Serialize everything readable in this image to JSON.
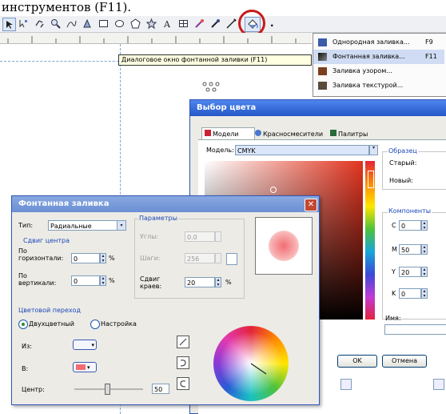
{
  "heading": "инструментов (F11).",
  "toolbar": {
    "icons": [
      "pick-tool",
      "shape-tool",
      "crop-tool",
      "zoom-tool",
      "freehand-tool",
      "rectangle-tool",
      "ellipse-tool",
      "polygon-tool",
      "text-tool",
      "table-tool",
      "interactive-tool",
      "eyedropper-tool",
      "outline-tool",
      "fill-tool"
    ]
  },
  "tooltip": "Диалоговое окно фонтанной заливки (F11)",
  "fill_menu": {
    "items": [
      {
        "label": "Однородная заливка...",
        "shortcut": "F9",
        "color": "#3b5ca8"
      },
      {
        "label": "Фонтанная заливка...",
        "shortcut": "F11",
        "color": "#2b2b2b"
      },
      {
        "label": "Заливка узором...",
        "shortcut": "",
        "color": "#7b3f1e"
      },
      {
        "label": "Заливка текстурой...",
        "shortcut": "",
        "color": "#5a4a3a"
      }
    ]
  },
  "color_picker": {
    "title": "Выбор цвета",
    "tabs": [
      "Модели",
      "Красносмесители",
      "Палитры"
    ],
    "model_label": "Модель:",
    "model_value": "CMYK",
    "sample_label": "Образец",
    "old_label": "Старый:",
    "new_label": "Новый:",
    "components_label": "Компоненты",
    "components": [
      {
        "name": "C",
        "value": "0"
      },
      {
        "name": "M",
        "value": "50"
      },
      {
        "name": "Y",
        "value": "20"
      },
      {
        "name": "K",
        "value": "0"
      }
    ],
    "name_label": "Имя:",
    "ok_label": "OK",
    "cancel_label": "Отмена"
  },
  "fountain": {
    "title": "Фонтанная заливка",
    "type_label": "Тип:",
    "type_value": "Радиальные",
    "center_label": "Сдвиг центра",
    "horizontal_label": "По горизонтали:",
    "horizontal_value": "0",
    "vertical_label": "По вертикали:",
    "vertical_value": "0",
    "percent": "%",
    "params_label": "Параметры",
    "steps_label": "Углы:",
    "steps_value": "0.0",
    "shift_label": "Шаги:",
    "shift_value": "256",
    "edge_label": "Сдвиг краев:",
    "edge_value": "20",
    "blend_label": "Цветовой переход",
    "two_color_label": "Двухцветный",
    "custom_label": "Настройка",
    "from_label": "Из:",
    "to_label": "В:",
    "mid_label": "Центр:",
    "mid_value": "50"
  }
}
